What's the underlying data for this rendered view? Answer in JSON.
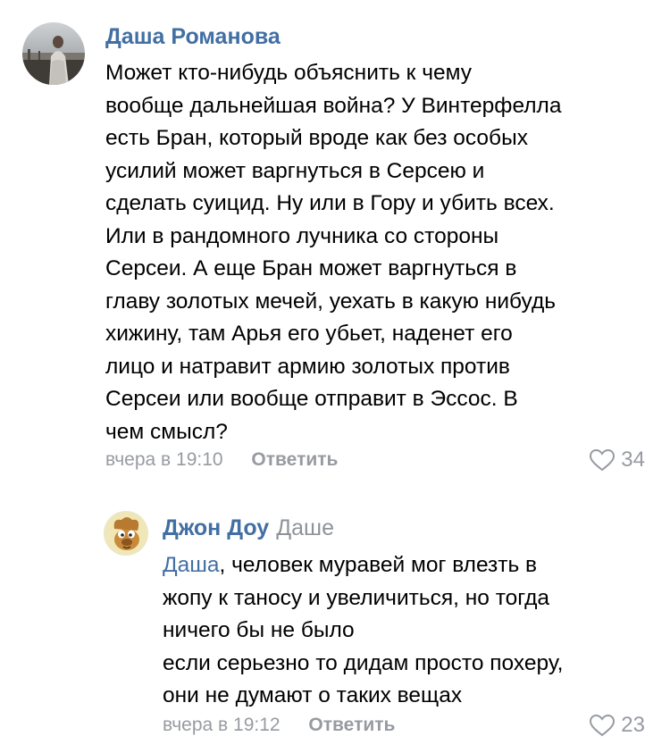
{
  "comments": [
    {
      "author": "Даша Романова",
      "text_lines": [
        "Может кто-нибудь объяснить к чему",
        "вообще дальнейшая война? У Винтерфелла",
        "есть Бран, который вроде как без особых",
        "усилий может варгнуться в Серсею и",
        "сделать суицид. Ну или в Гору и убить всех.",
        "Или в рандомного лучника со стороны",
        "Серсеи. А еще Бран может варгнуться в",
        "главу золотых мечей, уехать в какую нибудь",
        "хижину, там Арья его убьет, наденет его",
        "лицо и натравит армию золотых против",
        "Серсеи или вообще отправит в Эссос. В",
        "чем смысл?"
      ],
      "time": "вчера в 19:10",
      "reply_label": "Ответить",
      "likes": "34"
    }
  ],
  "reply": {
    "author": "Джон Доу",
    "reply_to": "Даше",
    "mention": "Даша",
    "first_line_rest": ", человек муравей мог влезть в",
    "text_lines": [
      "жопу к таносу и увеличиться, но тогда",
      "ничего бы не было",
      "если серьезно то дидам просто похеру,",
      "они не думают о таких вещах"
    ],
    "time": "вчера в 19:12",
    "reply_label": "Ответить",
    "likes": "23"
  },
  "colors": {
    "link": "#426fa3",
    "muted": "#979ba1",
    "text": "#000000"
  },
  "icons": {
    "like": "heart-icon"
  }
}
